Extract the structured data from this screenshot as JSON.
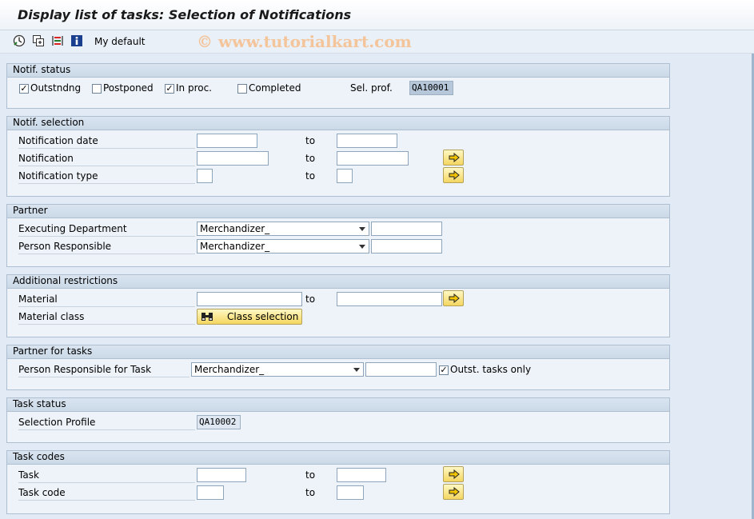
{
  "title": "Display list of tasks: Selection of Notifications",
  "toolbar": {
    "variant_label": "My default"
  },
  "watermark": "© www.tutorialkart.com",
  "to_label": "to",
  "notif_status": {
    "header": "Notif. status",
    "outstanding": {
      "label": "Outstndng",
      "checked": true
    },
    "postponed": {
      "label": "Postponed",
      "checked": false
    },
    "in_process": {
      "label": "In proc.",
      "checked": true
    },
    "completed": {
      "label": "Completed",
      "checked": false
    },
    "sel_prof_label": "Sel. prof.",
    "sel_prof_value": "QA10001"
  },
  "notif_selection": {
    "header": "Notif. selection",
    "notification_date": "Notification date",
    "notification": "Notification",
    "notification_type": "Notification type"
  },
  "partner": {
    "header": "Partner",
    "executing_department": {
      "label": "Executing Department",
      "value": "Merchandizer_"
    },
    "person_responsible": {
      "label": "Person Responsible",
      "value": "Merchandizer_"
    }
  },
  "additional": {
    "header": "Additional restrictions",
    "material": "Material",
    "material_class": "Material class",
    "class_selection": "Class selection"
  },
  "partner_tasks": {
    "header": "Partner for tasks",
    "person_responsible_task": {
      "label": "Person Responsible for Task",
      "value": "Merchandizer_"
    },
    "outst_tasks_only": {
      "label": "Outst. tasks only",
      "checked": true
    }
  },
  "task_status": {
    "header": "Task status",
    "selection_profile": {
      "label": "Selection Profile",
      "value": "QA10002"
    }
  },
  "task_codes": {
    "header": "Task codes",
    "task": "Task",
    "task_code": "Task code"
  }
}
